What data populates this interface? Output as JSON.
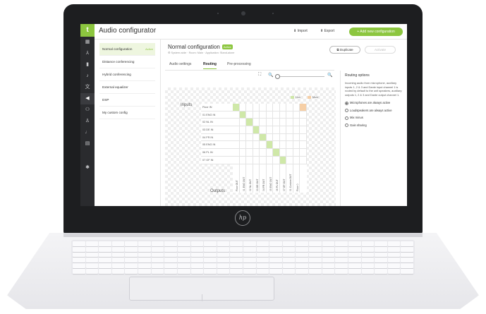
{
  "app": {
    "title": "Audio configurator",
    "import_label": "Import",
    "export_label": "Export",
    "add_label": "Add new configuration",
    "brand_glyph": "t",
    "accent_color": "#8cc63f"
  },
  "nav_icons": [
    "grid-icon",
    "network-icon",
    "device-icon",
    "microphone-icon",
    "translate-icon",
    "speaker-icon",
    "users-icon",
    "person-icon",
    "mic-icon",
    "document-icon",
    "settings-icon"
  ],
  "configs": [
    {
      "label": "Normal configuration",
      "tag": "Active"
    },
    {
      "label": "Distance conferencing",
      "tag": ""
    },
    {
      "label": "Hybrid conferencing",
      "tag": ""
    },
    {
      "label": "External equalizer",
      "tag": ""
    },
    {
      "label": "DSP",
      "tag": ""
    },
    {
      "label": "My custom config",
      "tag": ""
    }
  ],
  "detail": {
    "title": "Normal configuration",
    "status": "Active",
    "crumbs": "⚙ System-wide  ·  Room: Main  ·  Application: Stand-alone",
    "duplicate_label": "Duplicate",
    "activate_label": "Activate",
    "tabs": [
      "Audio settings",
      "Routing",
      "Pre-processing"
    ],
    "active_tab": "Routing"
  },
  "routing": {
    "inputs_title": "Inputs",
    "outputs_title": "Outputs",
    "legend_link": "Link",
    "legend_mute": "Mute",
    "link_color": "#cfe8a8",
    "mute_color": "#f6cfa6",
    "inputs": [
      "Floor IN",
      "01 ENG IN",
      "02 NL IN",
      "03 DE IN",
      "04 FR IN",
      "05 ENG IN",
      "06 PL IN",
      "07 GF IN",
      "01 Custom IN"
    ],
    "outputs": [
      "Floor OUT",
      "01 ENG OUT",
      "02 NL OUT",
      "03 DE OUT",
      "04 FR OUT",
      "05 ENG OUT",
      "06 PL OUT",
      "07 GF OUT",
      "01 Custom OUT",
      "Floor 0"
    ]
  },
  "options": {
    "title": "Routing options",
    "description": "Incoming audio from microphone, auxiliary inputs 1, 2 & 3 and Dante input channel 1 is routed by default to the unit speakers, auxiliary outputs 1, 2 & 3 and Dante output channel 1.",
    "radios": [
      {
        "label": "Microphones are always active",
        "selected": true
      },
      {
        "label": "Loudspeakers are always active",
        "selected": false
      },
      {
        "label": "Mix minus",
        "selected": false
      },
      {
        "label": "Gain sharing",
        "selected": false
      }
    ]
  },
  "device": {
    "logo": "hp"
  }
}
